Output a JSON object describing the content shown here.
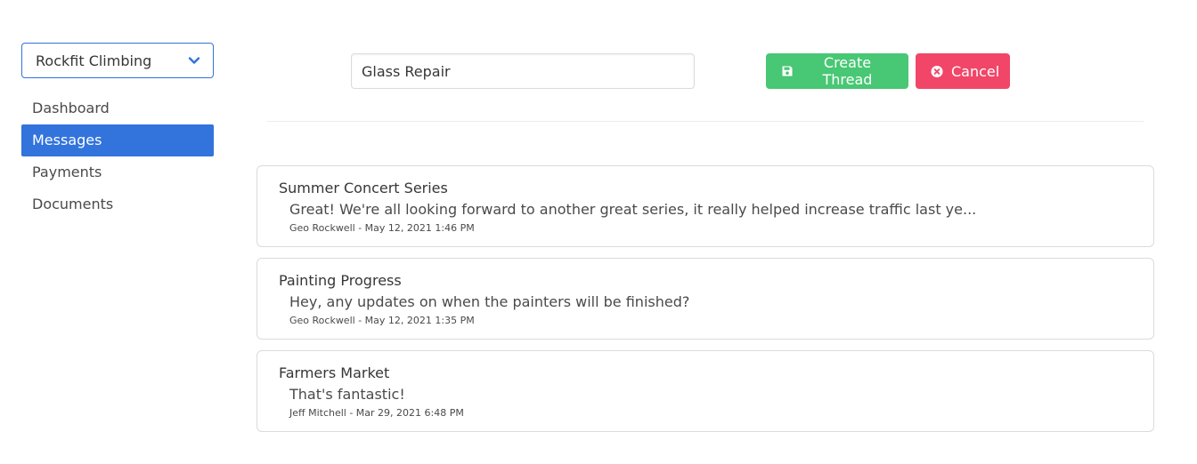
{
  "sidebar": {
    "org_select": {
      "value": "Rockfit Climbing",
      "icon": "chevron-down-icon"
    },
    "menu": [
      {
        "label": "Dashboard",
        "active": false
      },
      {
        "label": "Messages",
        "active": true
      },
      {
        "label": "Payments",
        "active": false
      },
      {
        "label": "Documents",
        "active": false
      }
    ]
  },
  "compose": {
    "subject_value": "Glass Repair",
    "create_label": "Create Thread",
    "create_icon": "save-icon",
    "cancel_label": "Cancel",
    "cancel_icon": "times-circle-icon"
  },
  "threads": [
    {
      "title": "Summer Concert Series",
      "preview": "Great! We're all looking forward to another great series, it really helped increase traffic last ye...",
      "meta": "Geo Rockwell - May 12, 2021 1:46 PM"
    },
    {
      "title": "Painting Progress",
      "preview": "Hey, any updates on when the painters will be finished?",
      "meta": "Geo Rockwell - May 12, 2021 1:35 PM"
    },
    {
      "title": "Farmers Market",
      "preview": "That's fantastic!",
      "meta": "Jeff Mitchell - Mar 29, 2021 6:48 PM"
    }
  ],
  "colors": {
    "primary": "#3273dc",
    "success": "#48c774",
    "danger": "#f14668"
  }
}
